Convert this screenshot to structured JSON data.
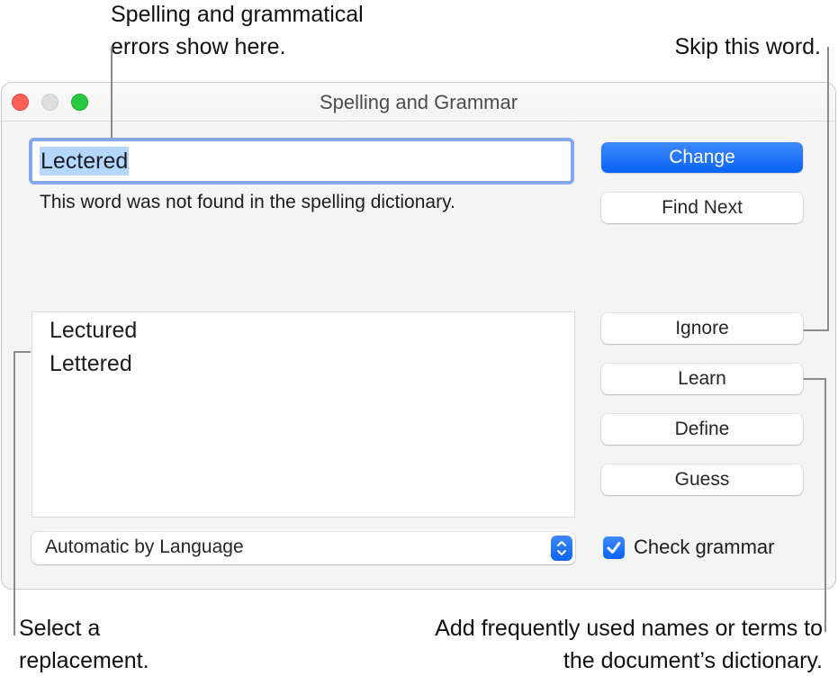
{
  "callouts": {
    "errors": [
      "Spelling and grammatical",
      "errors show here."
    ],
    "skip": "Skip this word.",
    "select": [
      "Select a",
      "replacement."
    ],
    "learn": [
      "Add frequently used names or terms to",
      "the document’s dictionary."
    ]
  },
  "window": {
    "title": "Spelling and Grammar",
    "controls": [
      "close",
      "minimize",
      "zoom"
    ]
  },
  "word_field": {
    "value": "Lectered",
    "selected": true
  },
  "message": "This word was not found in the spelling dictionary.",
  "buttons": {
    "change": "Change",
    "find_next": "Find Next",
    "ignore": "Ignore",
    "learn": "Learn",
    "define": "Define",
    "guess": "Guess"
  },
  "suggestions": [
    "Lectured",
    "Lettered"
  ],
  "language_select": {
    "value": "Automatic by Language",
    "icon": "up-down-chevron-icon"
  },
  "check_grammar": {
    "label": "Check grammar",
    "checked": true
  },
  "colors": {
    "accent": "#0a63f6",
    "focus_ring": "#82a8f0",
    "selection": "#b3d7ff",
    "close": "#fe5f57",
    "zoom": "#28c840"
  }
}
